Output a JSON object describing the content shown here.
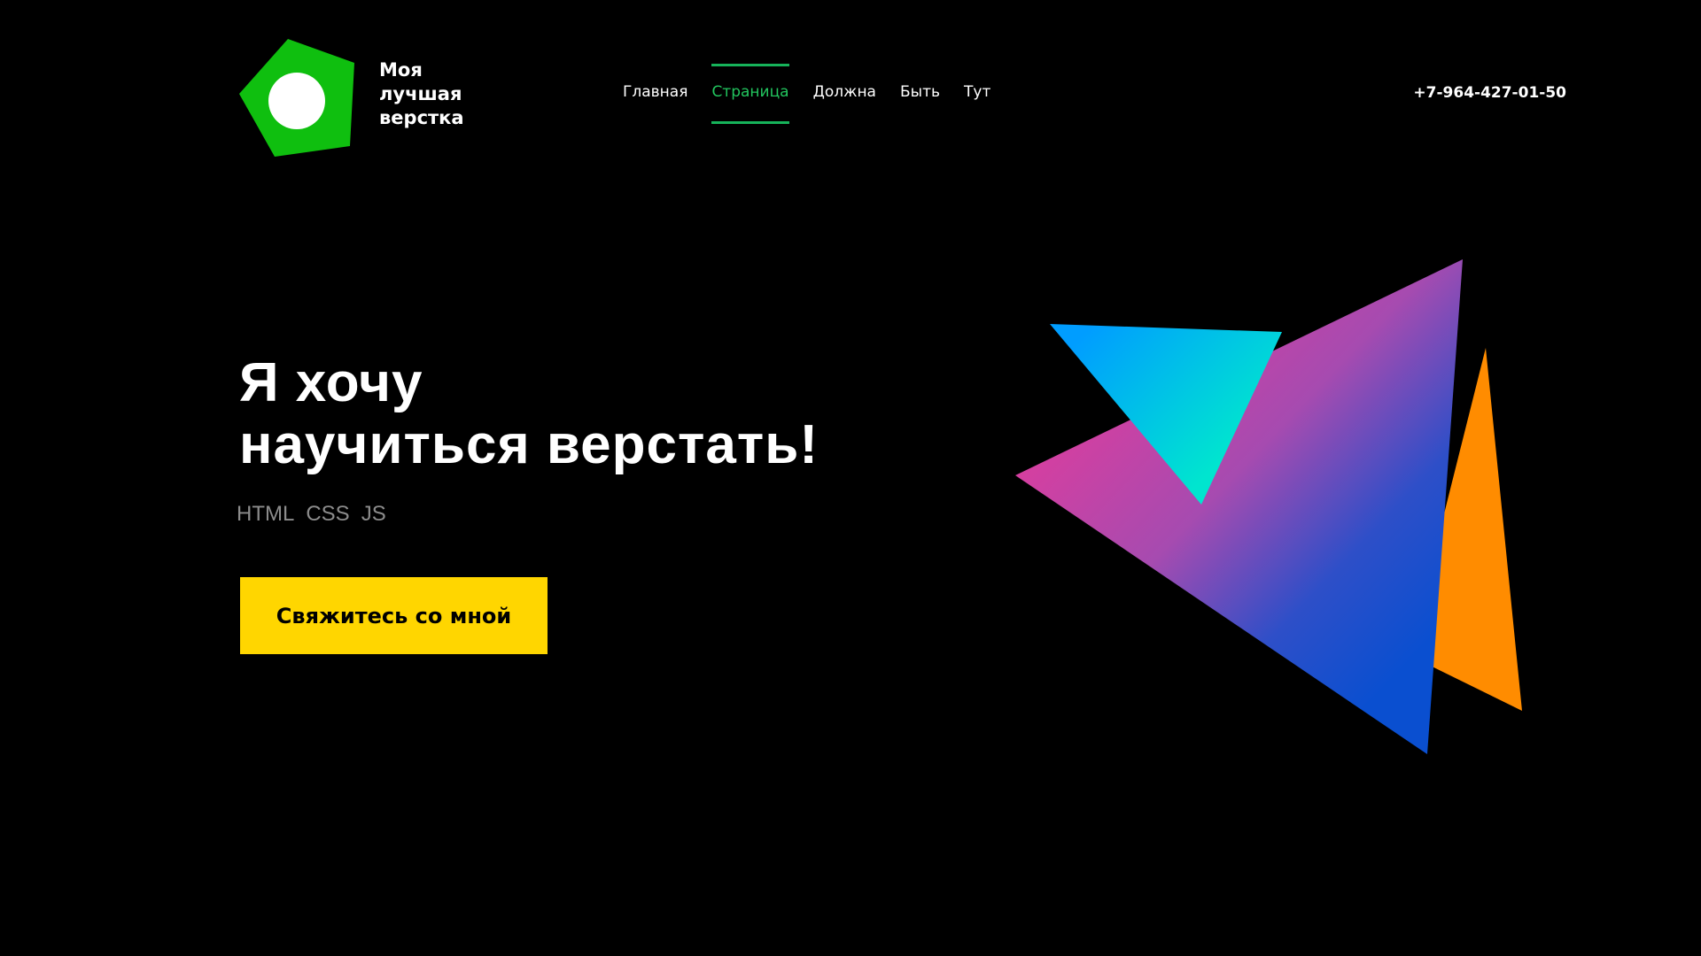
{
  "header": {
    "logo_lines": [
      "Моя",
      "лучшая",
      "верстка"
    ],
    "nav": [
      {
        "label": "Главная",
        "active": false
      },
      {
        "label": "Страница",
        "active": true
      },
      {
        "label": "Должна",
        "active": false
      },
      {
        "label": "Быть",
        "active": false
      },
      {
        "label": "Тут",
        "active": false
      }
    ],
    "phone": "+7-964-427-01-50"
  },
  "hero": {
    "title_lines": [
      "Я хочу",
      "научиться верстать!"
    ],
    "tech": [
      "HTML",
      "CSS",
      "JS"
    ],
    "cta_label": "Свяжитесь со мной"
  },
  "colors": {
    "background": "#000000",
    "logo_green": "#0fbf0f",
    "nav_active": "#22c55e",
    "cta_yellow": "#ffd600",
    "shape_orange": "#ff8c00",
    "shape_gradient_start": "#e43b9b",
    "shape_gradient_end": "#0a4fd0",
    "shape_cyan_start": "#009dff",
    "shape_cyan_end": "#00e5cf"
  }
}
